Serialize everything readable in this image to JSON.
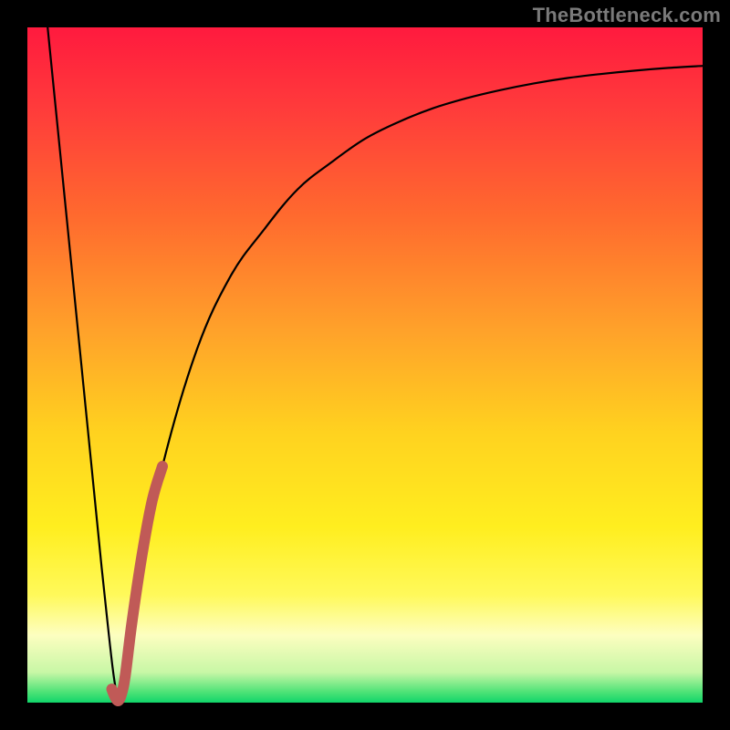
{
  "watermark": "TheBottleneck.com",
  "chart_data": {
    "type": "line",
    "title": "",
    "xlabel": "",
    "ylabel": "",
    "xlim": [
      0,
      100
    ],
    "ylim": [
      0,
      100
    ],
    "grid": false,
    "legend": false,
    "series": [
      {
        "name": "bottleneck-curve",
        "color": "#000000",
        "x": [
          3,
          7,
          11,
          13.5,
          15,
          17,
          20,
          25,
          30,
          35,
          40,
          45,
          50,
          55,
          60,
          65,
          70,
          75,
          80,
          85,
          90,
          95,
          100
        ],
        "y": [
          100,
          60,
          20,
          0.2,
          8,
          20,
          35,
          52,
          63,
          70,
          76,
          80,
          83.5,
          86,
          88,
          89.5,
          90.7,
          91.7,
          92.5,
          93.1,
          93.6,
          94.0,
          94.3
        ]
      },
      {
        "name": "highlight-segment",
        "color": "#c05a57",
        "x": [
          12.5,
          13,
          13.5,
          14,
          14.5,
          15.5,
          17,
          18.5,
          20
        ],
        "y": [
          2.0,
          0.8,
          0.3,
          1.5,
          4,
          12,
          22,
          30,
          35
        ]
      }
    ],
    "gradient_stops": [
      {
        "offset": 0.0,
        "color": "#ff1a3e"
      },
      {
        "offset": 0.12,
        "color": "#ff3b3b"
      },
      {
        "offset": 0.28,
        "color": "#ff6a2e"
      },
      {
        "offset": 0.45,
        "color": "#ffa22a"
      },
      {
        "offset": 0.6,
        "color": "#ffd21f"
      },
      {
        "offset": 0.74,
        "color": "#ffee1f"
      },
      {
        "offset": 0.84,
        "color": "#fff95a"
      },
      {
        "offset": 0.9,
        "color": "#fdfec0"
      },
      {
        "offset": 0.955,
        "color": "#c8f7a6"
      },
      {
        "offset": 0.985,
        "color": "#4be276"
      },
      {
        "offset": 1.0,
        "color": "#11d56a"
      }
    ]
  }
}
